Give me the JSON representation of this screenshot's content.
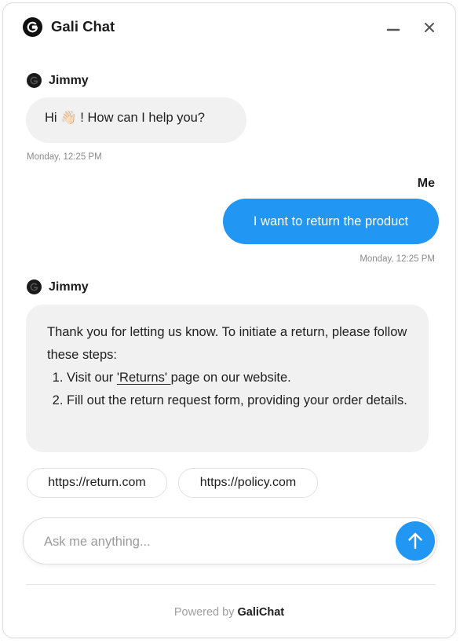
{
  "header": {
    "title": "Gali Chat",
    "logo_icon": "gali-logo-icon",
    "minimize_icon": "minimize-icon",
    "close_icon": "close-icon"
  },
  "messages": [
    {
      "sender": "Jimmy",
      "text_before": "Hi ",
      "emoji": "👋🏻",
      "text_after": " ! How can I help you?",
      "timestamp": "Monday, 12:25 PM"
    },
    {
      "sender": "Me",
      "text": "I want to return the product",
      "timestamp": "Monday, 12:25 PM"
    },
    {
      "sender": "Jimmy",
      "intro": "Thank you for letting us know. To initiate a return, please follow these steps:",
      "steps": [
        {
          "before": "Visit our ",
          "link": "'Returns' ",
          "after": "page on our website."
        },
        {
          "text": "Fill out the return request form, providing your order details."
        }
      ]
    }
  ],
  "suggestions": [
    "https://return.com",
    "https://policy.com"
  ],
  "composer": {
    "placeholder": "Ask me anything...",
    "send_icon": "arrow-up-icon"
  },
  "footer": {
    "powered_by": "Powered by",
    "brand": "GaliChat"
  },
  "colors": {
    "accent": "#2196f3",
    "incoming_bubble": "#f1f1f1",
    "timestamp": "#8a8a8a"
  }
}
